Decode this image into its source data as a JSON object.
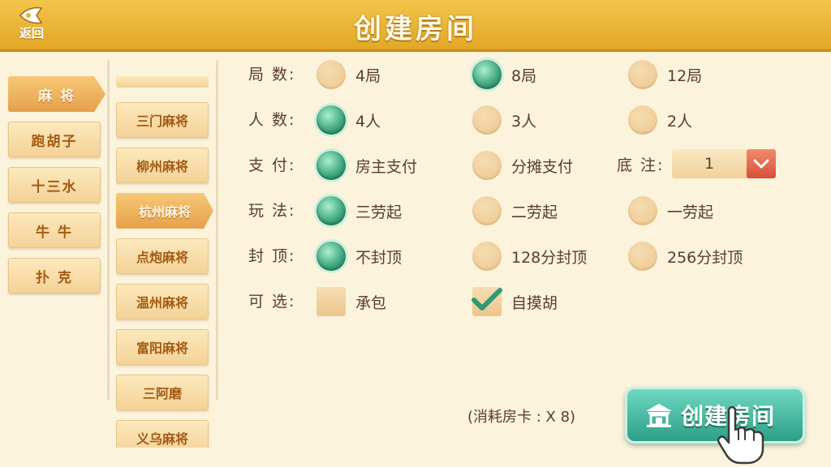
{
  "header": {
    "title": "创建房间",
    "back_label": "返回"
  },
  "categories": [
    {
      "label": "麻 将",
      "active": true
    },
    {
      "label": "跑胡子",
      "active": false
    },
    {
      "label": "十三水",
      "active": false
    },
    {
      "label": "牛 牛",
      "active": false
    },
    {
      "label": "扑 克",
      "active": false
    }
  ],
  "sub_games": [
    {
      "label": "三门麻将",
      "active": false
    },
    {
      "label": "柳州麻将",
      "active": false
    },
    {
      "label": "杭州麻将",
      "active": true
    },
    {
      "label": "点炮麻将",
      "active": false
    },
    {
      "label": "温州麻将",
      "active": false
    },
    {
      "label": "富阳麻将",
      "active": false
    },
    {
      "label": "三阿磨",
      "active": false
    },
    {
      "label": "义乌麻将",
      "active": false
    }
  ],
  "options": {
    "rounds": {
      "label": "局 数:",
      "choices": [
        "4局",
        "8局",
        "12局"
      ],
      "selected": 1
    },
    "players": {
      "label": "人 数:",
      "choices": [
        "4人",
        "3人",
        "2人"
      ],
      "selected": 0
    },
    "payment": {
      "label": "支 付:",
      "choices": [
        "房主支付",
        "分摊支付"
      ],
      "selected": 0
    },
    "base_bet": {
      "label": "底 注:",
      "value": "1"
    },
    "play_style": {
      "label": "玩 法:",
      "choices": [
        "三劳起",
        "二劳起",
        "一劳起"
      ],
      "selected": 0
    },
    "cap": {
      "label": "封 顶:",
      "choices": [
        "不封顶",
        "128分封顶",
        "256分封顶"
      ],
      "selected": 0
    },
    "extras": {
      "label": "可 选:",
      "choices": [
        "承包",
        "自摸胡"
      ],
      "checked": [
        false,
        true
      ]
    }
  },
  "cost_text": "(消耗房卡 : X 8)",
  "create_button_label": "创建房间",
  "colors": {
    "header": "#e9b230",
    "selected_radio": "#3aa07a",
    "create_button": "#2d9e88"
  }
}
